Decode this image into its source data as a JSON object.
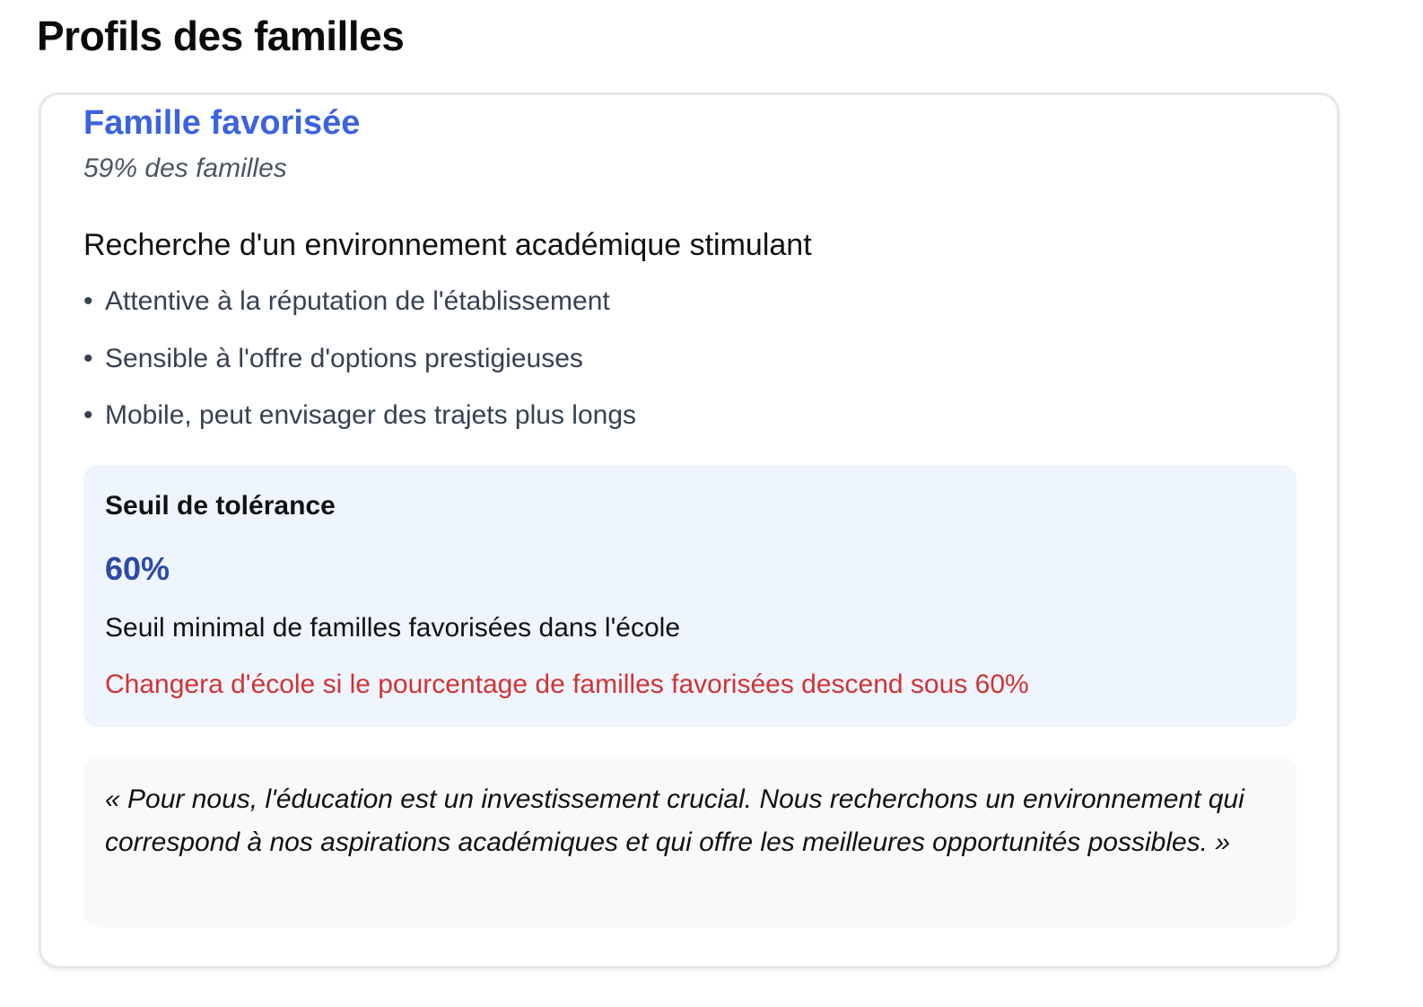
{
  "page": {
    "title": "Profils des familles"
  },
  "profile": {
    "name": "Famille favorisée",
    "share": "59% des familles",
    "headline": "Recherche d'un environnement académique stimulant",
    "bullet_glyph": "•",
    "traits": [
      "Attentive à la réputation de l'établissement",
      "Sensible à l'offre d'options prestigieuses",
      "Mobile, peut envisager des trajets plus longs"
    ],
    "tolerance": {
      "title": "Seuil de tolérance",
      "value": "60%",
      "description": "Seuil minimal de familles favorisées dans l'école",
      "warning": "Changera d'école si le pourcentage de familles favorisées descend sous 60%"
    },
    "quote": "« Pour nous, l'éducation est un investissement crucial. Nous recherchons un environnement qui correspond à nos aspirations académiques et qui offre les meilleures opportunités possibles. »"
  },
  "colors": {
    "accent_blue": "#3b63e0",
    "value_blue": "#2d4aa6",
    "warning_red": "#d03434",
    "tolerance_bg": "#eff5fe",
    "quote_bg": "#f8f9fb"
  }
}
